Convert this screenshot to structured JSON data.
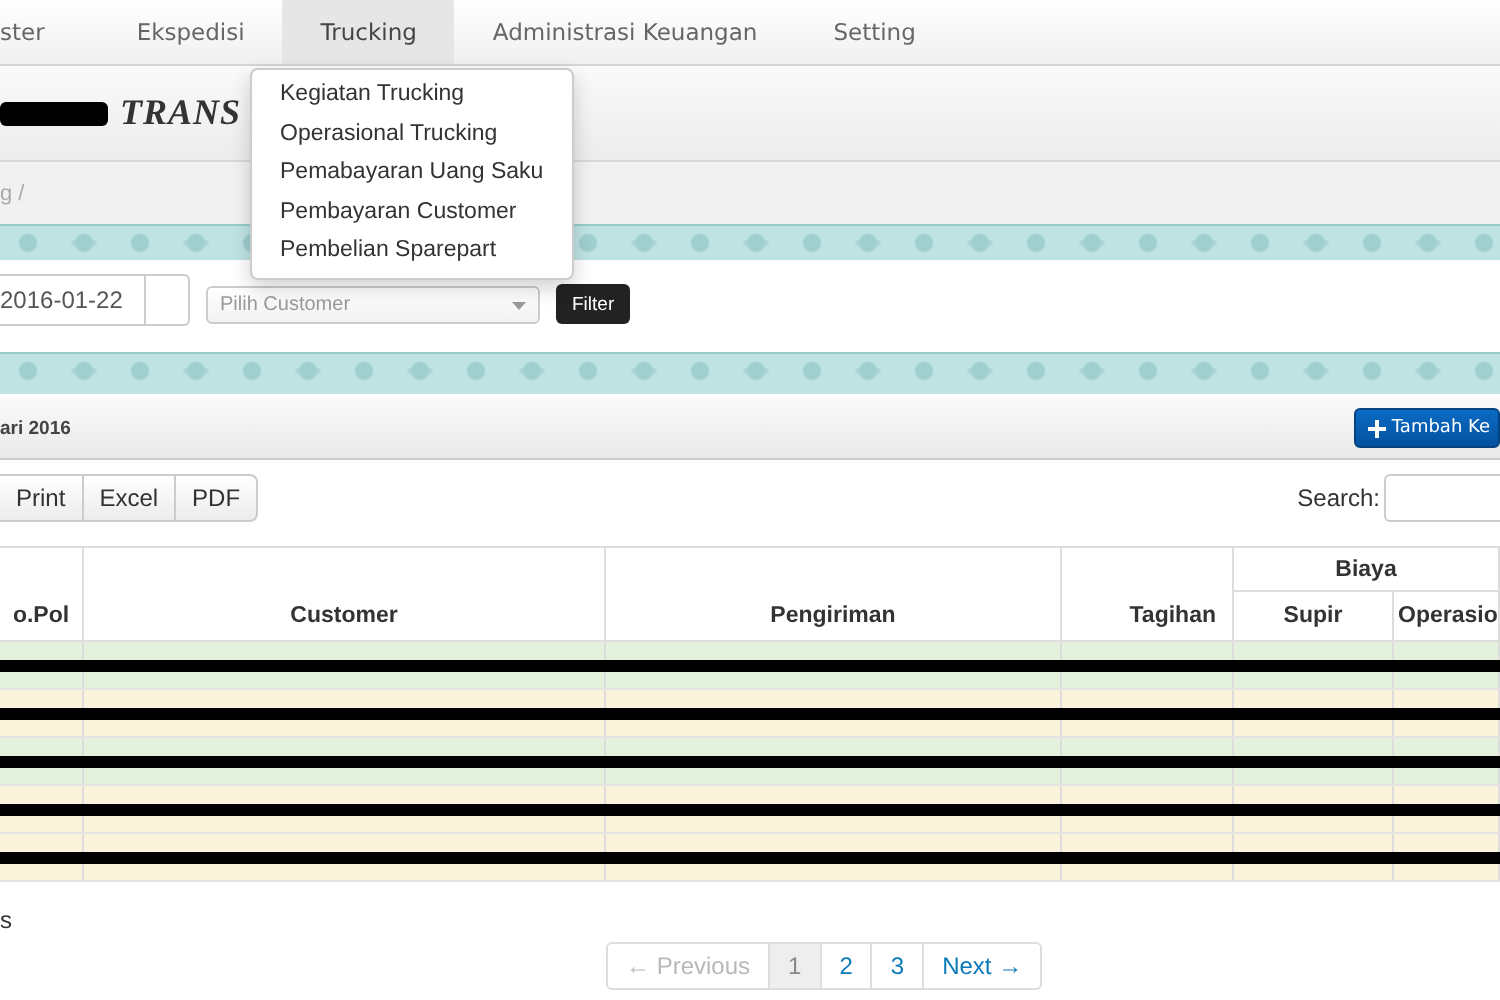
{
  "navbar": {
    "items": [
      {
        "label": "ster",
        "selected": false
      },
      {
        "label": "Ekspedisi",
        "selected": false
      },
      {
        "label": "Trucking",
        "selected": true
      },
      {
        "label": "Administrasi Keuangan",
        "selected": false
      },
      {
        "label": "Setting",
        "selected": false
      }
    ]
  },
  "dropdown": {
    "items": [
      "Kegiatan Trucking",
      "Operasional Trucking",
      "Pemabayaran Uang Saku",
      "Pembayaran Customer",
      "Pembelian Sparepart"
    ]
  },
  "page_title": "TRANS",
  "breadcrumb": "g /",
  "filter": {
    "date": "2016-01-22",
    "customer_placeholder": "Pilih Customer",
    "button": "Filter"
  },
  "panel": {
    "title": "ari 2016",
    "add_button": "Tambah Ke"
  },
  "export_buttons": [
    "Print",
    "Excel",
    "PDF"
  ],
  "search": {
    "label": "Search:"
  },
  "table": {
    "columns": [
      "o.Pol",
      "Customer",
      "Pengiriman",
      "Tagihan",
      "Supir",
      "Operasio"
    ],
    "group": "Biaya",
    "rows": [
      {
        "color": "#e4f1dc"
      },
      {
        "color": "#fbf3dc"
      },
      {
        "color": "#e4f1dc"
      },
      {
        "color": "#fbf3dc"
      },
      {
        "color": "#fbf3dc"
      }
    ]
  },
  "info": "s",
  "pagination": [
    {
      "label": "← Previous",
      "selected": false,
      "disabled": true
    },
    {
      "label": "1",
      "selected": true,
      "disabled": false
    },
    {
      "label": "2",
      "selected": false,
      "disabled": false
    },
    {
      "label": "3",
      "selected": false,
      "disabled": false
    },
    {
      "label": "Next →",
      "selected": false,
      "disabled": false
    }
  ]
}
